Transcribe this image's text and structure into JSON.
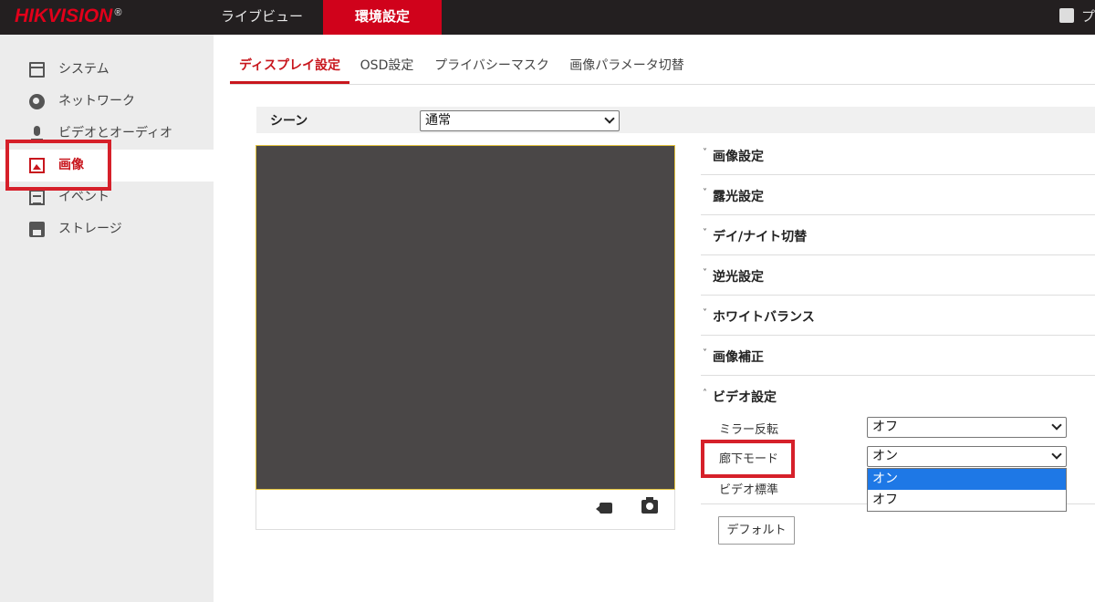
{
  "header": {
    "brand": "HIKVISION",
    "brand_mark": "®",
    "nav": [
      {
        "label": "ライブビュー",
        "active": false
      },
      {
        "label": "環境設定",
        "active": true
      }
    ],
    "right_text": "プ"
  },
  "sidebar": {
    "items": [
      {
        "label": "システム",
        "icon": "window-icon",
        "active": false
      },
      {
        "label": "ネットワーク",
        "icon": "globe-icon",
        "active": false
      },
      {
        "label": "ビデオとオーディオ",
        "icon": "microphone-icon",
        "active": false
      },
      {
        "label": "画像",
        "icon": "image-icon",
        "active": true
      },
      {
        "label": "イベント",
        "icon": "calendar-icon",
        "active": false
      },
      {
        "label": "ストレージ",
        "icon": "floppy-icon",
        "active": false
      }
    ]
  },
  "tabs": [
    {
      "label": "ディスプレイ設定",
      "active": true
    },
    {
      "label": "OSD設定",
      "active": false
    },
    {
      "label": "プライバシーマスク",
      "active": false
    },
    {
      "label": "画像パラメータ切替",
      "active": false
    }
  ],
  "scene": {
    "label": "シーン",
    "value": "通常"
  },
  "preview": {
    "record_icon": "video-record-icon",
    "snapshot_icon": "camera-icon"
  },
  "sections": [
    {
      "label": "画像設定",
      "expanded": false
    },
    {
      "label": "露光設定",
      "expanded": false
    },
    {
      "label": "デイ/ナイト切替",
      "expanded": false
    },
    {
      "label": "逆光設定",
      "expanded": false
    },
    {
      "label": "ホワイトバランス",
      "expanded": false
    },
    {
      "label": "画像補正",
      "expanded": false
    },
    {
      "label": "ビデオ設定",
      "expanded": true
    }
  ],
  "video_settings": {
    "mirror": {
      "label": "ミラー反転",
      "value": "オフ"
    },
    "corridor": {
      "label": "廊下モード",
      "value": "オン",
      "options": [
        "オン",
        "オフ"
      ]
    },
    "standard": {
      "label": "ビデオ標準"
    }
  },
  "default_button": "デフォルト",
  "colors": {
    "brand_red": "#d0021b",
    "topbar": "#231f20",
    "highlight_blue": "#1e78e6",
    "annotation_red": "#d6202a"
  }
}
